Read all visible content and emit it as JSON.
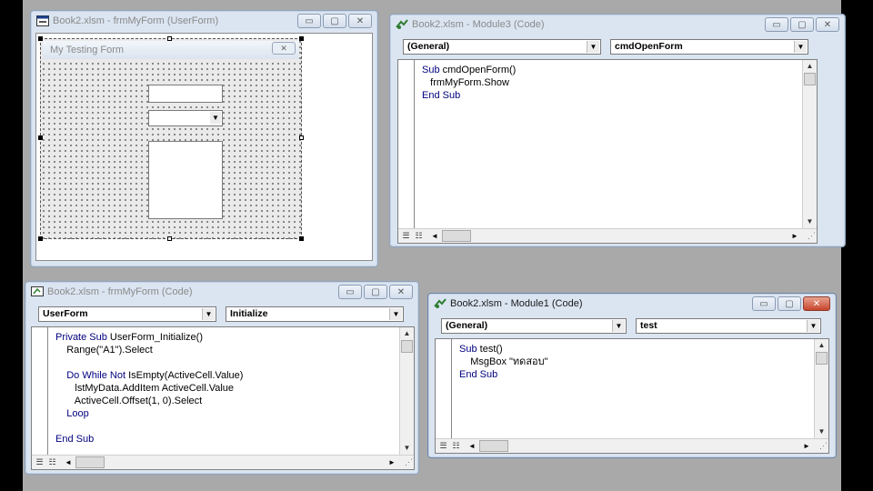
{
  "userform_window": {
    "title": "Book2.xlsm - frmMyForm (UserForm)",
    "minimize": "▭",
    "maximize": "▢",
    "close": "✕",
    "form": {
      "caption": "My Testing Form",
      "close": "✕",
      "combo_arrow": "▼"
    }
  },
  "module3_window": {
    "title": "Book2.xlsm - Module3 (Code)",
    "minimize": "▭",
    "maximize": "▢",
    "close": "✕",
    "object_combo": "(General)",
    "proc_combo": "cmdOpenForm",
    "code": [
      {
        "kw": "Sub ",
        "rest": "cmdOpenForm()"
      },
      {
        "kw": "",
        "rest": "   frmMyForm.Show"
      },
      {
        "kw": "End Sub",
        "rest": ""
      }
    ]
  },
  "form_code_window": {
    "title": "Book2.xlsm - frmMyForm (Code)",
    "minimize": "▭",
    "maximize": "▢",
    "close": "✕",
    "object_combo": "UserForm",
    "proc_combo": "Initialize",
    "code": [
      {
        "kw": "Private Sub ",
        "rest": "UserForm_Initialize()"
      },
      {
        "kw": "",
        "rest": "    Range(\"A1\").Select"
      },
      {
        "kw": "",
        "rest": ""
      },
      {
        "kw": "    Do While Not ",
        "rest": "IsEmpty(ActiveCell.Value)"
      },
      {
        "kw": "",
        "rest": "       lstMyData.AddItem ActiveCell.Value"
      },
      {
        "kw": "",
        "rest": "       ActiveCell.Offset(1, 0).Select"
      },
      {
        "kw": "    Loop",
        "rest": ""
      },
      {
        "kw": "",
        "rest": ""
      },
      {
        "kw": "End Sub",
        "rest": ""
      }
    ]
  },
  "module1_window": {
    "title": "Book2.xlsm - Module1 (Code)",
    "minimize": "▭",
    "maximize": "▢",
    "close": "✕",
    "object_combo": "(General)",
    "proc_combo": "test",
    "code": [
      {
        "kw": "Sub ",
        "rest": "test()"
      },
      {
        "kw": "",
        "rest": "    MsgBox \"ทดสอบ\""
      },
      {
        "kw": "End Sub",
        "rest": ""
      }
    ]
  },
  "scroll": {
    "up": "▲",
    "down": "▼",
    "left": "◄",
    "right": "►",
    "combo_arrow": "▼"
  },
  "colors": {
    "desktop": "#a9a9a9",
    "keyword": "#00007f",
    "close_active": "#c7442c"
  }
}
